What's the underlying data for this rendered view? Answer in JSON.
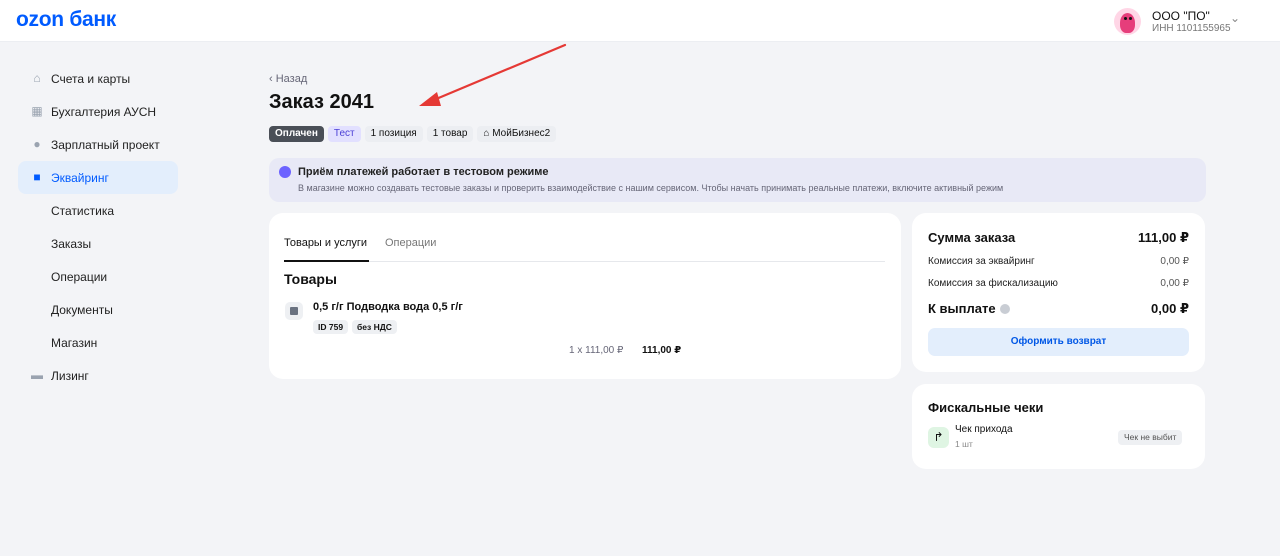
{
  "header": {
    "logo": "ozon банк",
    "account_name": "ООО \"ПО\"",
    "account_inn": "ИНН 1101155965",
    "chevron_icon": "chevron-down-icon"
  },
  "sidebar": {
    "items": [
      {
        "label": "Счета и карты",
        "icon": "home-icon"
      },
      {
        "label": "Бухгалтерия АУСН",
        "icon": "calculator-icon"
      },
      {
        "label": "Зарплатный проект",
        "icon": "people-icon"
      },
      {
        "label": "Эквайринг",
        "icon": "cart-icon",
        "active": true
      },
      {
        "label": "Статистика"
      },
      {
        "label": "Заказы"
      },
      {
        "label": "Операции"
      },
      {
        "label": "Документы"
      },
      {
        "label": "Магазин"
      },
      {
        "label": "Лизинг",
        "icon": "truck-icon"
      }
    ]
  },
  "page": {
    "back_label": "Назад",
    "title": "Заказ 2041",
    "badges": {
      "paid": "Оплачен",
      "test": "Тест",
      "positions": "1 позиция",
      "goods": "1 товар",
      "shop": "МойБизнес2"
    }
  },
  "notice": {
    "title": "Приём платежей работает в тестовом режиме",
    "text": "В магазине можно создавать тестовые заказы и проверить взаимодействие с нашим сервисом. Чтобы начать принимать реальные платежи, включите активный режим"
  },
  "order": {
    "tabs": [
      "Товары и услуги",
      "Операции"
    ],
    "section_title": "Товары",
    "product": {
      "name": "0,5 г/г Подводка вода 0,5 г/г",
      "tags": [
        "ID 759",
        "без НДС"
      ],
      "qty": "1 x 111,00 ₽",
      "total": "111,00 ₽"
    }
  },
  "summary": {
    "sum_label": "Сумма заказа",
    "sum_value": "111,00 ₽",
    "acq_label": "Комиссия за эквайринг",
    "acq_value": "0,00 ₽",
    "fisc_label": "Комиссия за фискализацию",
    "fisc_value": "0,00 ₽",
    "payout_label": "К выплате",
    "payout_value": "0,00 ₽",
    "refund_button": "Оформить возврат"
  },
  "fiscal": {
    "title": "Фискальные чеки",
    "receipt_name": "Чек прихода",
    "receipt_count": "1 шт",
    "receipt_status": "Чек не выбит"
  },
  "colors": {
    "brand": "#005bff",
    "annotation_arrow": "#e53935"
  }
}
